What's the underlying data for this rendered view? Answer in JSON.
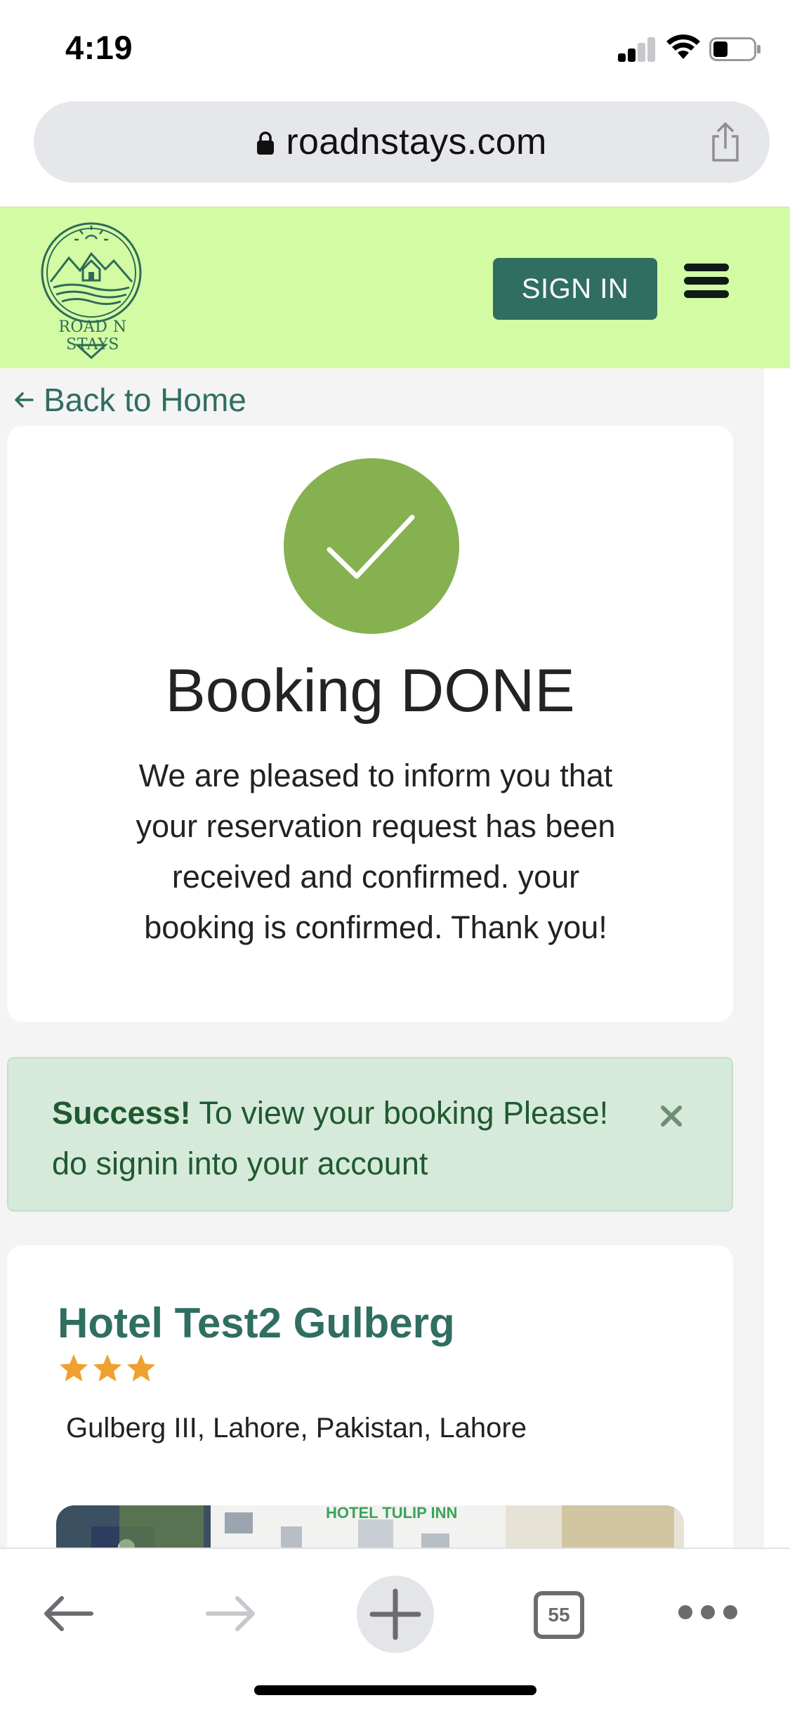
{
  "status_bar": {
    "time": "4:19",
    "icons": [
      "cellular-signal-icon",
      "wifi-icon",
      "battery-icon"
    ]
  },
  "browser": {
    "url": "roadnstays.com",
    "lock_icon": "lock-icon",
    "share_icon": "share-icon"
  },
  "header": {
    "logo_text": "ROAD N STAYS",
    "signin_label": "SIGN IN",
    "menu_icon": "hamburger-menu-icon",
    "bg_color": "#d3fba3",
    "accent_color": "#2f6e61"
  },
  "page": {
    "back_link": "Back to Home"
  },
  "confirmation": {
    "icon": "checkmark-icon",
    "icon_color": "#86b150",
    "title": "Booking DONE",
    "message": "We are pleased to inform you that your reservation request has been received and confirmed. your booking is confirmed. Thank you!"
  },
  "alert": {
    "strong": "Success!",
    "text": " To view your booking Please! do signin into your account",
    "close_icon": "close-icon",
    "bg_color": "#d6eadb"
  },
  "hotel": {
    "name": "Hotel Test2 Gulberg",
    "rating": 3,
    "address": "Gulberg III, Lahore, Pakistan, Lahore",
    "image_sign": "HOTEL TULIP INN",
    "star_color": "#f0a030"
  },
  "toolbar": {
    "tab_count": "55",
    "icons": [
      "back-arrow-icon",
      "forward-arrow-icon",
      "new-tab-plus-icon",
      "tabs-icon",
      "more-icon"
    ]
  }
}
